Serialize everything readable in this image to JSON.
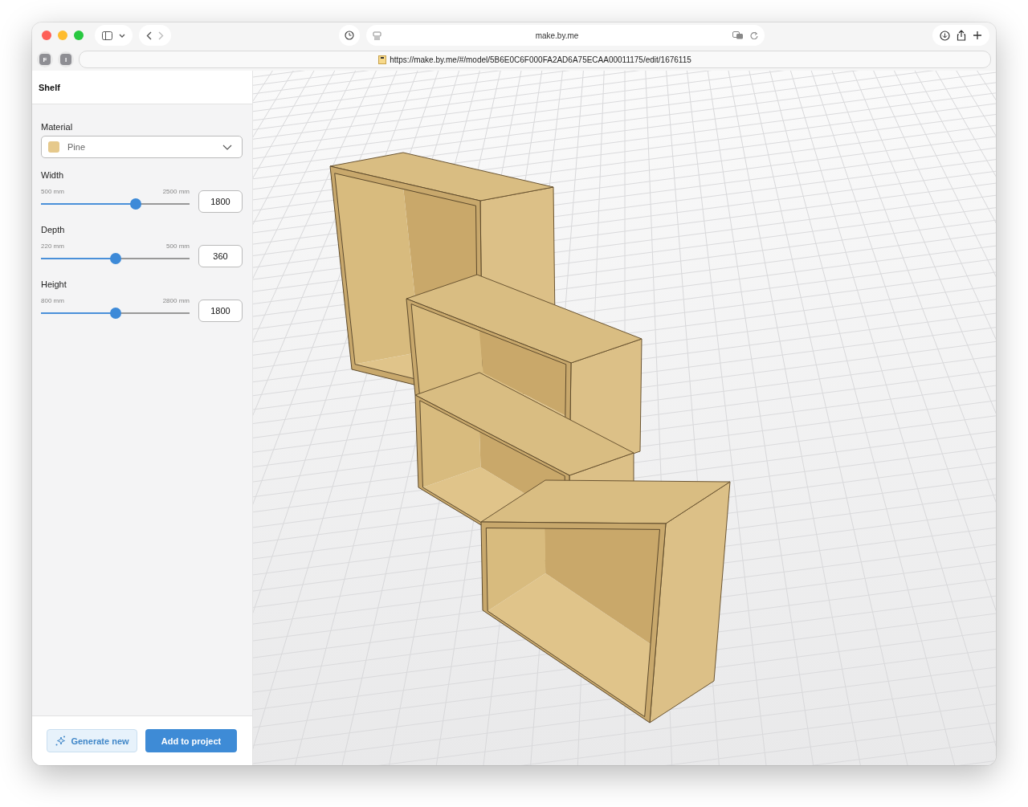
{
  "browser": {
    "address": "make.by.me",
    "url": "https://make.by.me/#/model/5B6E0C6F000FA2AD6A75ECAA00011175/edit/1676115",
    "bookmarks": [
      "F",
      "I"
    ]
  },
  "sidebar": {
    "title": "Shelf",
    "material": {
      "label": "Material",
      "value": "Pine"
    },
    "sliders": [
      {
        "label": "Width",
        "min": "500 mm",
        "max": "2500 mm",
        "value": "1800",
        "level": 0.64
      },
      {
        "label": "Depth",
        "min": "220 mm",
        "max": "500 mm",
        "value": "360",
        "level": 0.5
      },
      {
        "label": "Height",
        "min": "800 mm",
        "max": "2800 mm",
        "value": "1800",
        "level": 0.5
      }
    ],
    "buttons": [
      {
        "label": "Generate new",
        "kind": "secondary"
      },
      {
        "label": "Add to project",
        "kind": "primary"
      }
    ]
  }
}
